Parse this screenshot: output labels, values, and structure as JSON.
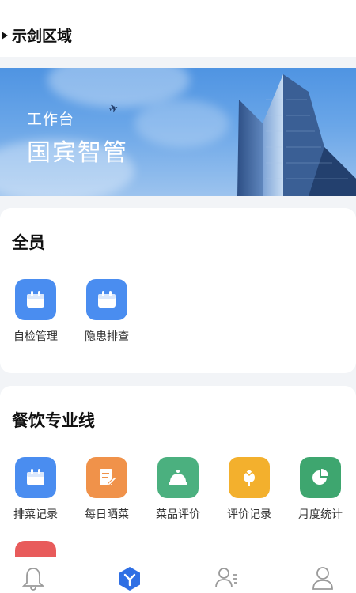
{
  "header": {
    "area_label": "示剑区域"
  },
  "banner": {
    "subtitle": "工作台",
    "title": "国宾智管"
  },
  "sections": [
    {
      "title": "全员",
      "items": [
        {
          "label": "自检管理",
          "icon": "calendar-icon",
          "color": "#4a8df0"
        },
        {
          "label": "隐患排查",
          "icon": "calendar-icon",
          "color": "#4a8df0"
        }
      ]
    },
    {
      "title": "餐饮专业线",
      "items": [
        {
          "label": "排菜记录",
          "icon": "calendar-icon",
          "color": "#4a8df0"
        },
        {
          "label": "每日晒菜",
          "icon": "document-edit-icon",
          "color": "#f0924a"
        },
        {
          "label": "菜品评价",
          "icon": "food-cloche-icon",
          "color": "#4bb07f"
        },
        {
          "label": "评价记录",
          "icon": "flower-icon",
          "color": "#f3b02d"
        },
        {
          "label": "月度统计",
          "icon": "pie-chart-icon",
          "color": "#3ea66f"
        }
      ]
    }
  ],
  "tabbar": {
    "tabs": [
      {
        "icon": "bell-icon",
        "active": false
      },
      {
        "icon": "workbench-icon",
        "active": true,
        "color": "#2f6fe4"
      },
      {
        "icon": "contacts-icon",
        "active": false
      },
      {
        "icon": "user-icon",
        "active": false
      }
    ]
  }
}
